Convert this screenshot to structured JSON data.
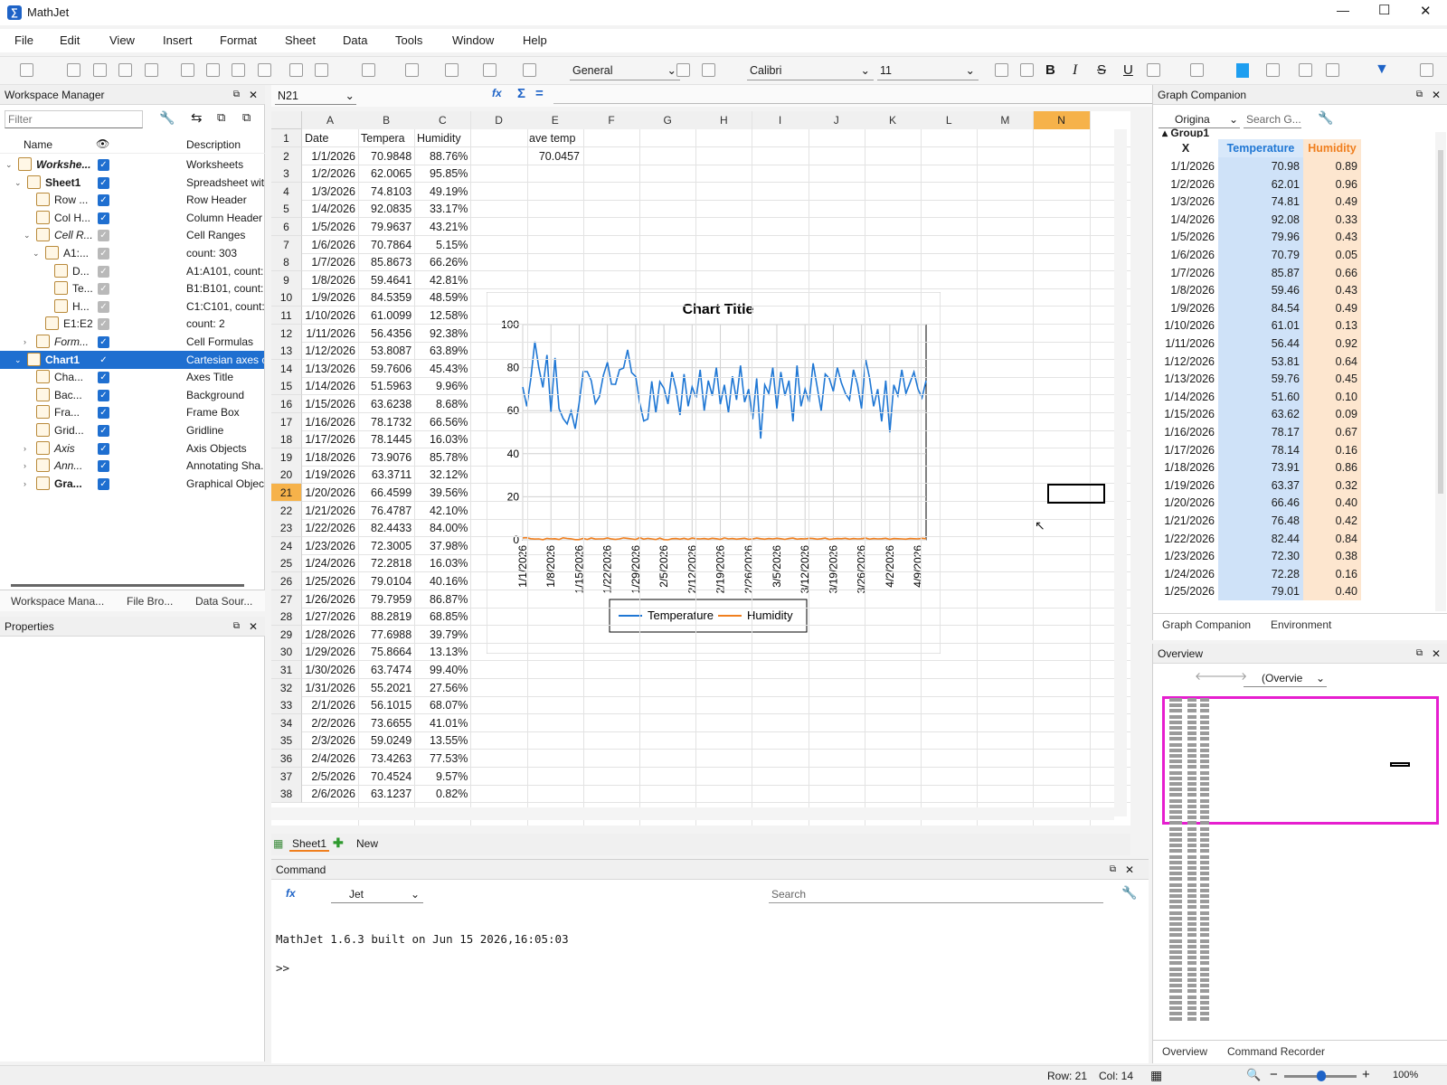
{
  "app": {
    "title": "MathJet"
  },
  "window_controls": {
    "minimize": "—",
    "maximize": "☐",
    "close": "✕"
  },
  "menu": [
    "File",
    "Edit",
    "View",
    "Insert",
    "Format",
    "Sheet",
    "Data",
    "Tools",
    "Window",
    "Help"
  ],
  "toolbar": {
    "number_format": "General",
    "font": "Calibri",
    "font_size": "11"
  },
  "formula_bar": {
    "cell_ref": "N21"
  },
  "workspace": {
    "title": "Workspace Manager",
    "filter_placeholder": "Filter",
    "columns": [
      "Name",
      "Description"
    ],
    "rows": [
      {
        "name": "Workshe...",
        "desc": "Worksheets",
        "indent": 0,
        "bold": true,
        "italic": true,
        "expander": "v",
        "checked": "on"
      },
      {
        "name": "Sheet1",
        "desc": "Spreadsheet wit..",
        "indent": 1,
        "bold": true,
        "italic": false,
        "expander": "v",
        "checked": "on"
      },
      {
        "name": "Row ...",
        "desc": "Row Header",
        "indent": 2,
        "bold": false,
        "italic": false,
        "expander": "",
        "checked": "on"
      },
      {
        "name": "Col H...",
        "desc": "Column Header",
        "indent": 2,
        "bold": false,
        "italic": false,
        "expander": "",
        "checked": "on"
      },
      {
        "name": "Cell R...",
        "desc": "Cell Ranges",
        "indent": 2,
        "bold": false,
        "italic": true,
        "expander": "v",
        "checked": "dis"
      },
      {
        "name": "A1:...",
        "desc": "count: 303",
        "indent": 3,
        "bold": false,
        "italic": false,
        "expander": "v",
        "checked": "dis"
      },
      {
        "name": "D...",
        "desc": "A1:A101, count:.",
        "indent": 4,
        "bold": false,
        "italic": false,
        "expander": "",
        "checked": "dis"
      },
      {
        "name": "Te...",
        "desc": "B1:B101, count: .",
        "indent": 4,
        "bold": false,
        "italic": false,
        "expander": "",
        "checked": "dis"
      },
      {
        "name": "H...",
        "desc": "C1:C101, count:.",
        "indent": 4,
        "bold": false,
        "italic": false,
        "expander": "",
        "checked": "dis"
      },
      {
        "name": "E1:E2",
        "desc": "count: 2",
        "indent": 3,
        "bold": false,
        "italic": false,
        "expander": "",
        "checked": "dis"
      },
      {
        "name": "Form...",
        "desc": "Cell Formulas",
        "indent": 2,
        "bold": false,
        "italic": true,
        "expander": ">",
        "checked": "on"
      },
      {
        "name": "Chart1",
        "desc": "Cartesian axes c..",
        "indent": 1,
        "bold": true,
        "italic": false,
        "expander": "v",
        "checked": "sel",
        "selected": true
      },
      {
        "name": "Cha...",
        "desc": "Axes Title",
        "indent": 2,
        "bold": false,
        "italic": false,
        "expander": "",
        "checked": "on"
      },
      {
        "name": "Bac...",
        "desc": "Background",
        "indent": 2,
        "bold": false,
        "italic": false,
        "expander": "",
        "checked": "on"
      },
      {
        "name": "Fra...",
        "desc": "Frame Box",
        "indent": 2,
        "bold": false,
        "italic": false,
        "expander": "",
        "checked": "on"
      },
      {
        "name": "Grid...",
        "desc": "Gridline",
        "indent": 2,
        "bold": false,
        "italic": false,
        "expander": "",
        "checked": "on"
      },
      {
        "name": "Axis",
        "desc": "Axis Objects",
        "indent": 2,
        "bold": false,
        "italic": true,
        "expander": ">",
        "checked": "on"
      },
      {
        "name": "Ann...",
        "desc": "Annotating Sha..",
        "indent": 2,
        "bold": false,
        "italic": true,
        "expander": ">",
        "checked": "on"
      },
      {
        "name": "Gra...",
        "desc": "Graphical Object",
        "indent": 2,
        "bold": true,
        "italic": false,
        "expander": ">",
        "checked": "on"
      }
    ],
    "tabs": [
      "Workspace Mana...",
      "File Bro...",
      "Data Sour..."
    ]
  },
  "properties": {
    "title": "Properties"
  },
  "sheet": {
    "columns": [
      "A",
      "B",
      "C",
      "D",
      "E",
      "F",
      "G",
      "H",
      "I",
      "J",
      "K",
      "L",
      "M",
      "N"
    ],
    "headers": {
      "a": "Date",
      "b": "Tempera",
      "c": "Humidity",
      "e": "ave temp"
    },
    "ave_temp": "70.0457",
    "rows": [
      [
        "1/1/2026",
        "70.9848",
        "88.76%"
      ],
      [
        "1/2/2026",
        "62.0065",
        "95.85%"
      ],
      [
        "1/3/2026",
        "74.8103",
        "49.19%"
      ],
      [
        "1/4/2026",
        "92.0835",
        "33.17%"
      ],
      [
        "1/5/2026",
        "79.9637",
        "43.21%"
      ],
      [
        "1/6/2026",
        "70.7864",
        "5.15%"
      ],
      [
        "1/7/2026",
        "85.8673",
        "66.26%"
      ],
      [
        "1/8/2026",
        "59.4641",
        "42.81%"
      ],
      [
        "1/9/2026",
        "84.5359",
        "48.59%"
      ],
      [
        "1/10/2026",
        "61.0099",
        "12.58%"
      ],
      [
        "1/11/2026",
        "56.4356",
        "92.38%"
      ],
      [
        "1/12/2026",
        "53.8087",
        "63.89%"
      ],
      [
        "1/13/2026",
        "59.7606",
        "45.43%"
      ],
      [
        "1/14/2026",
        "51.5963",
        "9.96%"
      ],
      [
        "1/15/2026",
        "63.6238",
        "8.68%"
      ],
      [
        "1/16/2026",
        "78.1732",
        "66.56%"
      ],
      [
        "1/17/2026",
        "78.1445",
        "16.03%"
      ],
      [
        "1/18/2026",
        "73.9076",
        "85.78%"
      ],
      [
        "1/19/2026",
        "63.3711",
        "32.12%"
      ],
      [
        "1/20/2026",
        "66.4599",
        "39.56%"
      ],
      [
        "1/21/2026",
        "76.4787",
        "42.10%"
      ],
      [
        "1/22/2026",
        "82.4433",
        "84.00%"
      ],
      [
        "1/23/2026",
        "72.3005",
        "37.98%"
      ],
      [
        "1/24/2026",
        "72.2818",
        "16.03%"
      ],
      [
        "1/25/2026",
        "79.0104",
        "40.16%"
      ],
      [
        "1/26/2026",
        "79.7959",
        "86.87%"
      ],
      [
        "1/27/2026",
        "88.2819",
        "68.85%"
      ],
      [
        "1/28/2026",
        "77.6988",
        "39.79%"
      ],
      [
        "1/29/2026",
        "75.8664",
        "13.13%"
      ],
      [
        "1/30/2026",
        "63.7474",
        "99.40%"
      ],
      [
        "1/31/2026",
        "55.2021",
        "27.56%"
      ],
      [
        "2/1/2026",
        "56.1015",
        "68.07%"
      ],
      [
        "2/2/2026",
        "73.6655",
        "41.01%"
      ],
      [
        "2/3/2026",
        "59.0249",
        "13.55%"
      ],
      [
        "2/4/2026",
        "73.4263",
        "77.53%"
      ],
      [
        "2/5/2026",
        "70.4524",
        "9.57%"
      ],
      [
        "2/6/2026",
        "63.1237",
        "0.82%"
      ]
    ],
    "tabs": {
      "sheet": "Sheet1",
      "new": "New"
    }
  },
  "chart_data": {
    "type": "line",
    "title": "Chart Title",
    "ylim": [
      0,
      100
    ],
    "yticks": [
      0,
      20,
      40,
      60,
      80,
      100
    ],
    "xtick_labels": [
      "1/1/2026",
      "1/8/2026",
      "1/15/2026",
      "1/22/2026",
      "1/29/2026",
      "2/5/2026",
      "2/12/2026",
      "2/19/2026",
      "2/26/2026",
      "3/5/2026",
      "3/12/2026",
      "3/19/2026",
      "3/26/2026",
      "4/2/2026",
      "4/9/2026"
    ],
    "x_start": "1/1/2026",
    "x_end": "4/11/2026",
    "grid": true,
    "legend": "bottom",
    "series": [
      {
        "name": "Temperature",
        "color": "#1f77d4",
        "values": [
          70.98,
          62.01,
          74.81,
          92.08,
          79.96,
          70.79,
          85.87,
          59.46,
          84.54,
          61.01,
          56.44,
          53.81,
          59.76,
          51.6,
          63.62,
          78.17,
          78.14,
          73.91,
          63.37,
          66.46,
          76.48,
          82.44,
          72.3,
          72.28,
          79.01,
          79.8,
          88.28,
          77.7,
          75.87,
          63.75,
          55.2,
          56.1,
          73.67,
          59.02,
          73.43,
          70.45,
          63.12,
          78,
          70,
          58,
          77,
          62,
          71,
          66,
          79,
          60,
          74,
          67,
          80,
          63,
          72,
          59,
          76,
          65,
          81,
          64,
          70,
          56,
          75,
          47,
          72,
          68,
          80,
          61,
          78,
          67,
          74,
          55,
          81,
          62,
          70,
          64,
          82,
          71,
          60,
          77,
          75,
          69,
          80,
          73,
          68,
          65,
          79,
          72,
          61,
          84,
          75,
          62,
          70,
          55,
          74,
          50,
          72,
          67,
          79,
          68,
          73,
          78,
          70,
          66,
          74
        ]
      },
      {
        "name": "Humidity",
        "color": "#f07f1e",
        "values": [
          0.89,
          0.96,
          0.49,
          0.33,
          0.43,
          0.05,
          0.66,
          0.43,
          0.49,
          0.13,
          0.92,
          0.64,
          0.45,
          0.1,
          0.09,
          0.67,
          0.16,
          0.86,
          0.32,
          0.4,
          0.42,
          0.84,
          0.38,
          0.16,
          0.4,
          0.87,
          0.69,
          0.4,
          0.13,
          0.99,
          0.28,
          0.68,
          0.41,
          0.14,
          0.78,
          0.1,
          0.01,
          0.5,
          0.6,
          0.3,
          0.7,
          0.2,
          0.8,
          0.5,
          0.4,
          0.6,
          0.3,
          0.7,
          0.5,
          0.2,
          0.9,
          0.4,
          0.6,
          0.3,
          0.5,
          0.7,
          0.2,
          0.4,
          0.8,
          0.5,
          0.3,
          0.6,
          0.4,
          0.7,
          0.5,
          0.2,
          0.6,
          0.8,
          0.3,
          0.5,
          0.4,
          0.7,
          0.6,
          0.3,
          0.5,
          0.8,
          0.2,
          0.4,
          0.6,
          0.5,
          0.7,
          0.3,
          0.6,
          0.4,
          0.5,
          0.8,
          0.3,
          0.6,
          0.4,
          0.5,
          0.7,
          0.2,
          0.6,
          0.5,
          0.4,
          0.3,
          0.6,
          0.5,
          0.4,
          0.7,
          0.5
        ]
      }
    ]
  },
  "graph_companion": {
    "title": "Graph Companion",
    "dropdown": "Origina",
    "search_placeholder": "Search G...",
    "group": "Group1",
    "columns": [
      "X",
      "Temperature",
      "Humidity"
    ],
    "rows": [
      [
        "1/1/2026",
        "70.98",
        "0.89"
      ],
      [
        "1/2/2026",
        "62.01",
        "0.96"
      ],
      [
        "1/3/2026",
        "74.81",
        "0.49"
      ],
      [
        "1/4/2026",
        "92.08",
        "0.33"
      ],
      [
        "1/5/2026",
        "79.96",
        "0.43"
      ],
      [
        "1/6/2026",
        "70.79",
        "0.05"
      ],
      [
        "1/7/2026",
        "85.87",
        "0.66"
      ],
      [
        "1/8/2026",
        "59.46",
        "0.43"
      ],
      [
        "1/9/2026",
        "84.54",
        "0.49"
      ],
      [
        "1/10/2026",
        "61.01",
        "0.13"
      ],
      [
        "1/11/2026",
        "56.44",
        "0.92"
      ],
      [
        "1/12/2026",
        "53.81",
        "0.64"
      ],
      [
        "1/13/2026",
        "59.76",
        "0.45"
      ],
      [
        "1/14/2026",
        "51.60",
        "0.10"
      ],
      [
        "1/15/2026",
        "63.62",
        "0.09"
      ],
      [
        "1/16/2026",
        "78.17",
        "0.67"
      ],
      [
        "1/17/2026",
        "78.14",
        "0.16"
      ],
      [
        "1/18/2026",
        "73.91",
        "0.86"
      ],
      [
        "1/19/2026",
        "63.37",
        "0.32"
      ],
      [
        "1/20/2026",
        "66.46",
        "0.40"
      ],
      [
        "1/21/2026",
        "76.48",
        "0.42"
      ],
      [
        "1/22/2026",
        "82.44",
        "0.84"
      ],
      [
        "1/23/2026",
        "72.30",
        "0.38"
      ],
      [
        "1/24/2026",
        "72.28",
        "0.16"
      ],
      [
        "1/25/2026",
        "79.01",
        "0.40"
      ]
    ],
    "tabs": [
      "Graph Companion",
      "Environment"
    ]
  },
  "overview": {
    "title": "Overview",
    "dropdown": "(Overvie",
    "tabs": [
      "Overview",
      "Command Recorder"
    ]
  },
  "command": {
    "title": "Command",
    "engine": "Jet",
    "search_placeholder": "Search",
    "output": "MathJet 1.6.3 built on Jun 15 2026,16:05:03",
    "prompt": ">>"
  },
  "status": {
    "row": "Row: 21",
    "col": "Col: 14",
    "zoom": "100%"
  }
}
